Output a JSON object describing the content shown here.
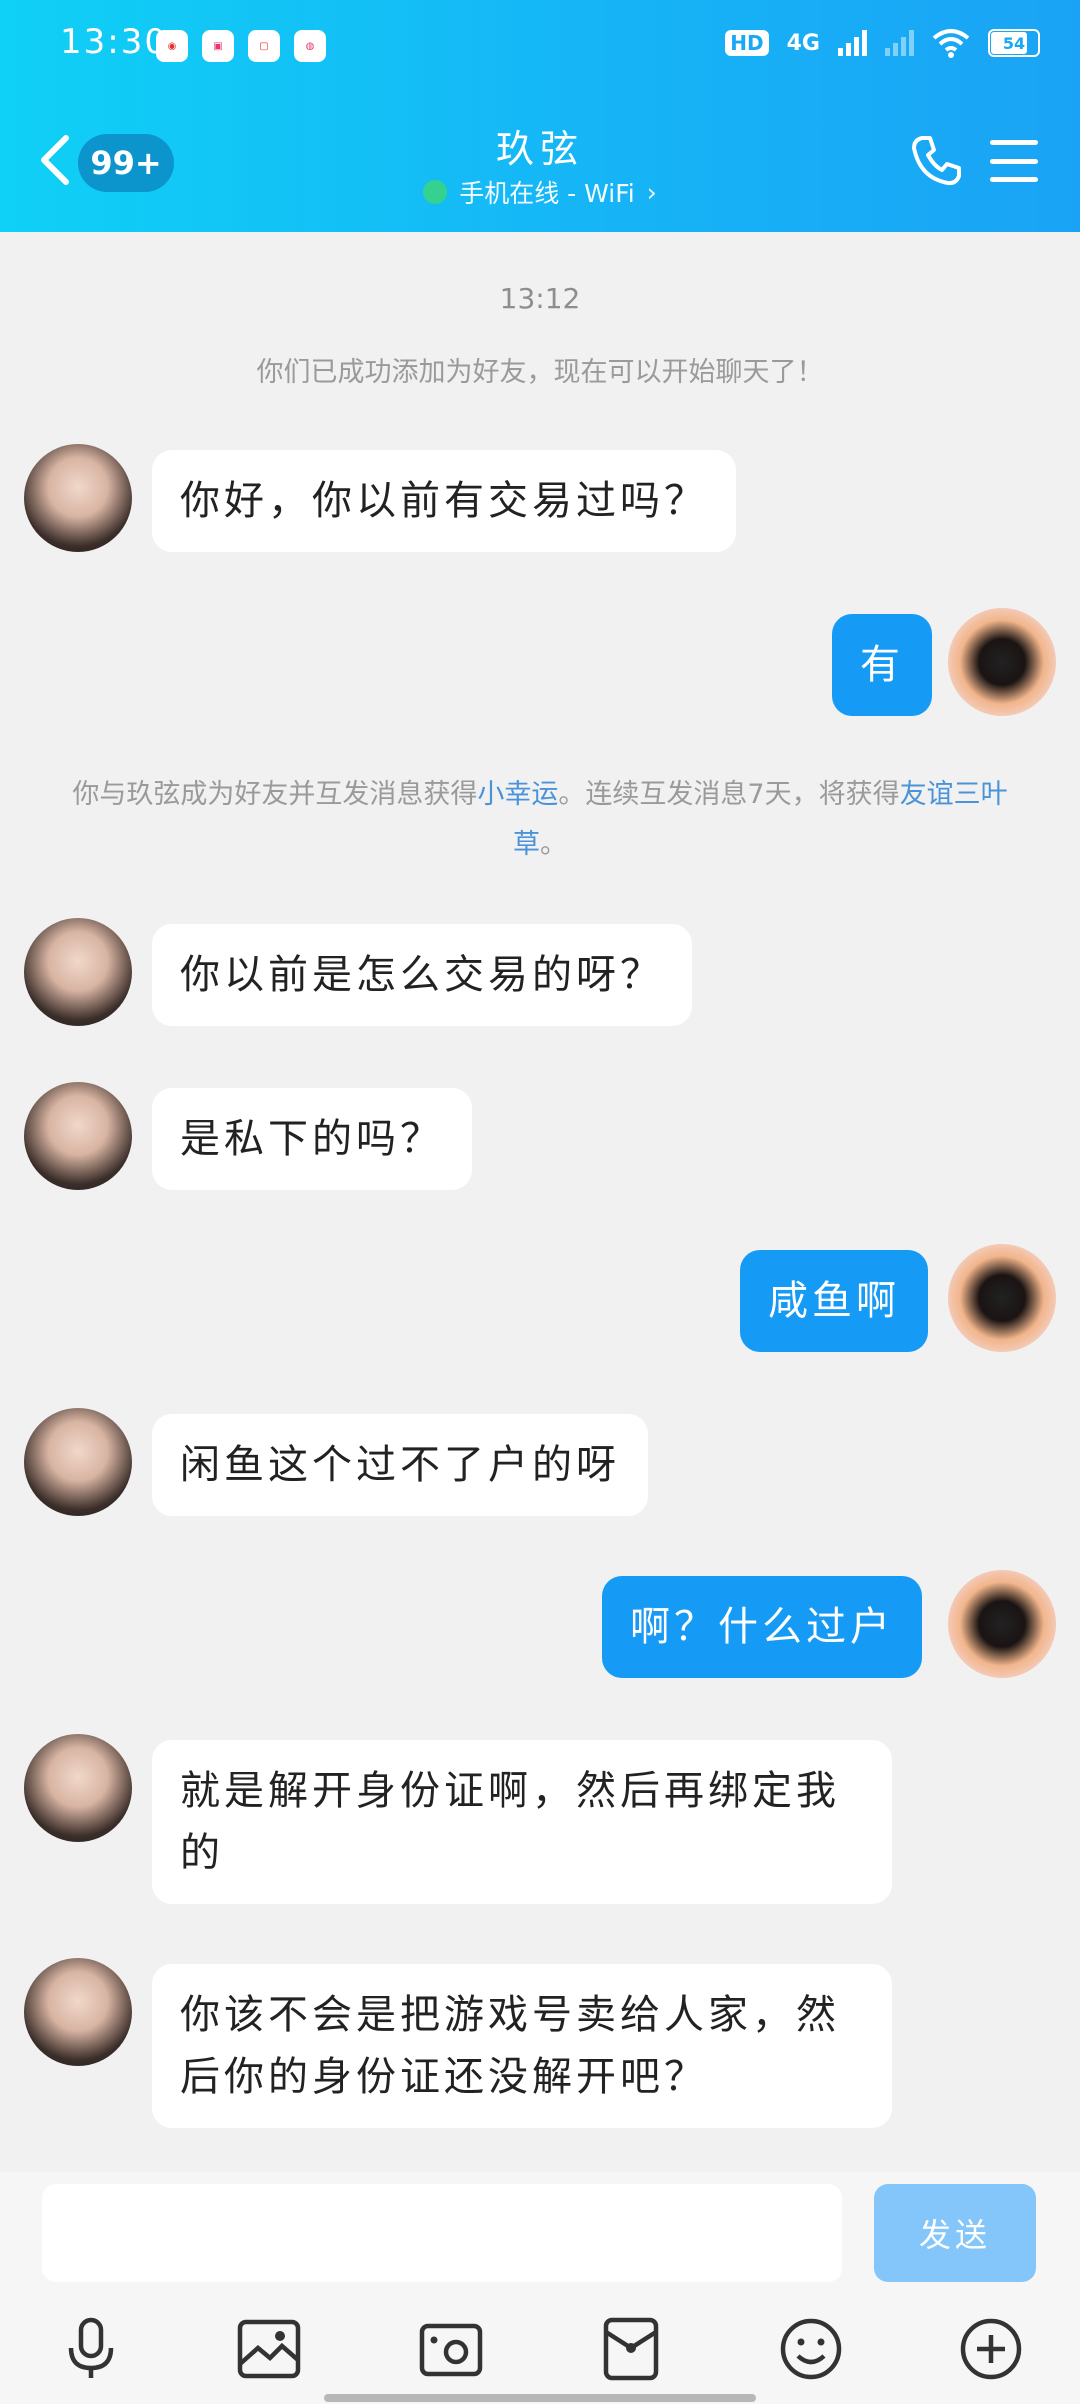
{
  "status_bar": {
    "time": "13:30",
    "apps": [
      "weibo",
      "bilibili",
      "xiaohongshu",
      "app"
    ],
    "hd": "HD",
    "network": "4G",
    "battery": "54"
  },
  "header": {
    "unread_badge": "99+",
    "title": "玖弦",
    "subtitle": "手机在线 - WiFi",
    "online_color": "#37d48a",
    "accent": "#16b5f6"
  },
  "chat": {
    "timestamp": "13:12",
    "system_added": "你们已成功添加为好友，现在可以开始聊天了！",
    "system_lucky": {
      "prefix": "你与玖弦成为好友并互发消息获得",
      "lucky": "小幸运",
      "middle": "。连续互发消息7天，将获得",
      "clover": "友谊三叶草",
      "suffix": "。"
    },
    "messages": [
      {
        "side": "in",
        "text": "你好，你以前有交易过吗？"
      },
      {
        "side": "out",
        "text": "有"
      },
      {
        "side": "in",
        "text": "你以前是怎么交易的呀？"
      },
      {
        "side": "in",
        "text": "是私下的吗？"
      },
      {
        "side": "out",
        "text": "咸鱼啊"
      },
      {
        "side": "in",
        "text": "闲鱼这个过不了户的呀"
      },
      {
        "side": "out",
        "text": "啊？什么过户"
      },
      {
        "side": "in",
        "text": "就是解开身份证啊，然后再绑定我的"
      },
      {
        "side": "in",
        "text": "你该不会是把游戏号卖给人家，然后你的身份证还没解开吧？"
      }
    ]
  },
  "input": {
    "placeholder": "",
    "send_label": "发送"
  },
  "toolbar": [
    "microphone-icon",
    "image-icon",
    "camera-icon",
    "red-packet-icon",
    "emoji-icon",
    "plus-icon"
  ]
}
